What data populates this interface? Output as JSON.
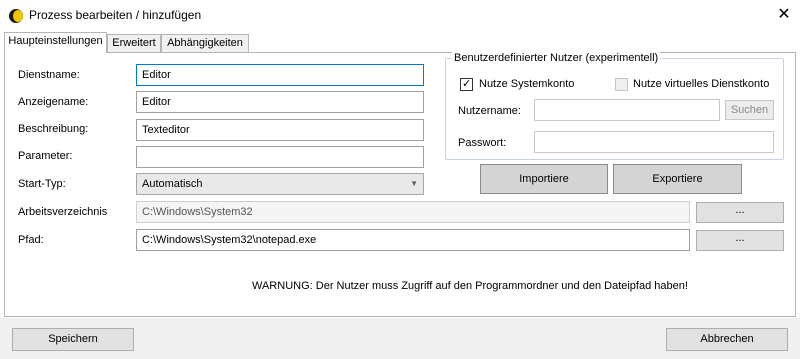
{
  "window": {
    "title": "Prozess bearbeiten / hinzufügen",
    "icon": "app-icon",
    "close_glyph": "✕"
  },
  "tabs": [
    {
      "label": "Haupteinstellungen",
      "active": true
    },
    {
      "label": "Erweitert",
      "active": false
    },
    {
      "label": "Abhängigkeiten",
      "active": false
    }
  ],
  "form": {
    "service_name": {
      "label": "Dienstname:",
      "value": "Editor"
    },
    "display_name": {
      "label": "Anzeigename:",
      "value": "Editor"
    },
    "description": {
      "label": "Beschreibung:",
      "value": "Texteditor"
    },
    "parameters": {
      "label": "Parameter:",
      "value": ""
    },
    "start_type": {
      "label": "Start-Typ:",
      "value": "Automatisch"
    },
    "working_dir": {
      "label": "Arbeitsverzeichnis",
      "value": "C:\\Windows\\System32",
      "browse": "..."
    },
    "path": {
      "label": "Pfad:",
      "value": "C:\\Windows\\System32\\notepad.exe",
      "browse": "..."
    }
  },
  "user_group": {
    "title": "Benutzerdefinierter Nutzer (experimentell)",
    "use_system_account": {
      "label": "Nutze Systemkonto",
      "checked": true
    },
    "use_virtual_account": {
      "label": "Nutze virtuelles Dienstkonto",
      "checked": false
    },
    "username": {
      "label": "Nutzername:",
      "value": ""
    },
    "search_button": "Suchen",
    "password": {
      "label": "Passwort:",
      "value": ""
    }
  },
  "actions": {
    "import": "Importiere",
    "export": "Exportiere"
  },
  "warning": "WARNUNG: Der Nutzer muss Zugriff auf den Programmordner und den Dateipfad haben!",
  "footer": {
    "save": "Speichern",
    "cancel": "Abbrechen"
  }
}
